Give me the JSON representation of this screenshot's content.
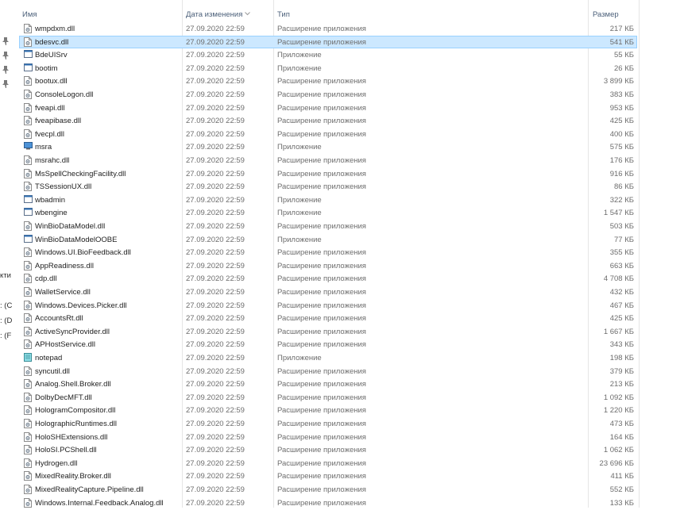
{
  "columns": {
    "name": "Имя",
    "date": "Дата изменения",
    "type": "Тип",
    "size": "Размер"
  },
  "nav": {
    "fragments": [
      "кти",
      ": (C",
      ": (D",
      ": (F"
    ]
  },
  "files": [
    {
      "name": "wmpdxm.dll",
      "date": "27.09.2020 22:59",
      "type": "Расширение приложения",
      "size": "217 КБ",
      "icon": "dll-icon"
    },
    {
      "name": "bdesvc.dll",
      "date": "27.09.2020 22:59",
      "type": "Расширение приложения",
      "size": "541 КБ",
      "icon": "dll-icon",
      "selected": true
    },
    {
      "name": "BdeUISrv",
      "date": "27.09.2020 22:59",
      "type": "Приложение",
      "size": "55 КБ",
      "icon": "exe-icon"
    },
    {
      "name": "bootim",
      "date": "27.09.2020 22:59",
      "type": "Приложение",
      "size": "26 КБ",
      "icon": "exe-icon"
    },
    {
      "name": "bootux.dll",
      "date": "27.09.2020 22:59",
      "type": "Расширение приложения",
      "size": "3 899 КБ",
      "icon": "dll-icon"
    },
    {
      "name": "ConsoleLogon.dll",
      "date": "27.09.2020 22:59",
      "type": "Расширение приложения",
      "size": "383 КБ",
      "icon": "dll-icon"
    },
    {
      "name": "fveapi.dll",
      "date": "27.09.2020 22:59",
      "type": "Расширение приложения",
      "size": "953 КБ",
      "icon": "dll-icon"
    },
    {
      "name": "fveapibase.dll",
      "date": "27.09.2020 22:59",
      "type": "Расширение приложения",
      "size": "425 КБ",
      "icon": "dll-icon"
    },
    {
      "name": "fvecpl.dll",
      "date": "27.09.2020 22:59",
      "type": "Расширение приложения",
      "size": "400 КБ",
      "icon": "dll-icon"
    },
    {
      "name": "msra",
      "date": "27.09.2020 22:59",
      "type": "Приложение",
      "size": "575 КБ",
      "icon": "remote-assist-icon"
    },
    {
      "name": "msrahc.dll",
      "date": "27.09.2020 22:59",
      "type": "Расширение приложения",
      "size": "176 КБ",
      "icon": "dll-icon"
    },
    {
      "name": "MsSpellCheckingFacility.dll",
      "date": "27.09.2020 22:59",
      "type": "Расширение приложения",
      "size": "916 КБ",
      "icon": "dll-icon"
    },
    {
      "name": "TSSessionUX.dll",
      "date": "27.09.2020 22:59",
      "type": "Расширение приложения",
      "size": "86 КБ",
      "icon": "dll-icon"
    },
    {
      "name": "wbadmin",
      "date": "27.09.2020 22:59",
      "type": "Приложение",
      "size": "322 КБ",
      "icon": "exe-icon"
    },
    {
      "name": "wbengine",
      "date": "27.09.2020 22:59",
      "type": "Приложение",
      "size": "1 547 КБ",
      "icon": "exe-icon"
    },
    {
      "name": "WinBioDataModel.dll",
      "date": "27.09.2020 22:59",
      "type": "Расширение приложения",
      "size": "503 КБ",
      "icon": "dll-icon"
    },
    {
      "name": "WinBioDataModelOOBE",
      "date": "27.09.2020 22:59",
      "type": "Приложение",
      "size": "77 КБ",
      "icon": "exe-icon"
    },
    {
      "name": "Windows.UI.BioFeedback.dll",
      "date": "27.09.2020 22:59",
      "type": "Расширение приложения",
      "size": "355 КБ",
      "icon": "dll-icon"
    },
    {
      "name": "AppReadiness.dll",
      "date": "27.09.2020 22:59",
      "type": "Расширение приложения",
      "size": "663 КБ",
      "icon": "dll-icon"
    },
    {
      "name": "cdp.dll",
      "date": "27.09.2020 22:59",
      "type": "Расширение приложения",
      "size": "4 708 КБ",
      "icon": "dll-icon"
    },
    {
      "name": "WalletService.dll",
      "date": "27.09.2020 22:59",
      "type": "Расширение приложения",
      "size": "432 КБ",
      "icon": "dll-icon"
    },
    {
      "name": "Windows.Devices.Picker.dll",
      "date": "27.09.2020 22:59",
      "type": "Расширение приложения",
      "size": "467 КБ",
      "icon": "dll-icon"
    },
    {
      "name": "AccountsRt.dll",
      "date": "27.09.2020 22:59",
      "type": "Расширение приложения",
      "size": "425 КБ",
      "icon": "dll-icon"
    },
    {
      "name": "ActiveSyncProvider.dll",
      "date": "27.09.2020 22:59",
      "type": "Расширение приложения",
      "size": "1 667 КБ",
      "icon": "dll-icon"
    },
    {
      "name": "APHostService.dll",
      "date": "27.09.2020 22:59",
      "type": "Расширение приложения",
      "size": "343 КБ",
      "icon": "dll-icon"
    },
    {
      "name": "notepad",
      "date": "27.09.2020 22:59",
      "type": "Приложение",
      "size": "198 КБ",
      "icon": "notepad-icon"
    },
    {
      "name": "syncutil.dll",
      "date": "27.09.2020 22:59",
      "type": "Расширение приложения",
      "size": "379 КБ",
      "icon": "dll-icon"
    },
    {
      "name": "Analog.Shell.Broker.dll",
      "date": "27.09.2020 22:59",
      "type": "Расширение приложения",
      "size": "213 КБ",
      "icon": "dll-icon"
    },
    {
      "name": "DolbyDecMFT.dll",
      "date": "27.09.2020 22:59",
      "type": "Расширение приложения",
      "size": "1 092 КБ",
      "icon": "dll-icon"
    },
    {
      "name": "HologramCompositor.dll",
      "date": "27.09.2020 22:59",
      "type": "Расширение приложения",
      "size": "1 220 КБ",
      "icon": "dll-icon"
    },
    {
      "name": "HolographicRuntimes.dll",
      "date": "27.09.2020 22:59",
      "type": "Расширение приложения",
      "size": "473 КБ",
      "icon": "dll-icon"
    },
    {
      "name": "HoloSHExtensions.dll",
      "date": "27.09.2020 22:59",
      "type": "Расширение приложения",
      "size": "164 КБ",
      "icon": "dll-icon"
    },
    {
      "name": "HoloSI.PCShell.dll",
      "date": "27.09.2020 22:59",
      "type": "Расширение приложения",
      "size": "1 062 КБ",
      "icon": "dll-icon"
    },
    {
      "name": "Hydrogen.dll",
      "date": "27.09.2020 22:59",
      "type": "Расширение приложения",
      "size": "23 696 КБ",
      "icon": "dll-icon"
    },
    {
      "name": "MixedReality.Broker.dll",
      "date": "27.09.2020 22:59",
      "type": "Расширение приложения",
      "size": "411 КБ",
      "icon": "dll-icon"
    },
    {
      "name": "MixedRealityCapture.Pipeline.dll",
      "date": "27.09.2020 22:59",
      "type": "Расширение приложения",
      "size": "552 КБ",
      "icon": "dll-icon"
    },
    {
      "name": "Windows.Internal.Feedback.Analog.dll",
      "date": "27.09.2020 22:59",
      "type": "Расширение приложения",
      "size": "133 КБ",
      "icon": "dll-icon"
    }
  ]
}
